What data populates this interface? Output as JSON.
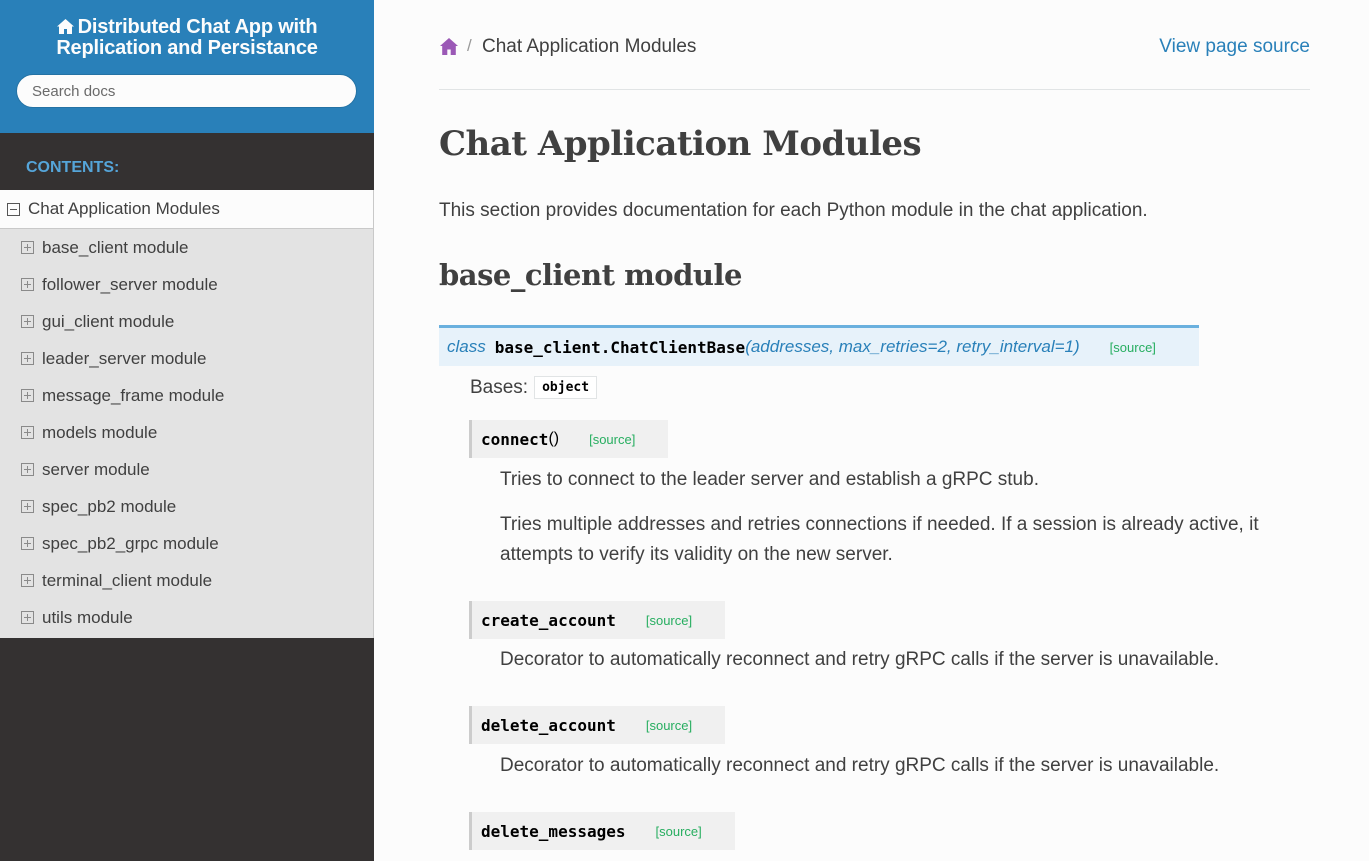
{
  "sidebar": {
    "project_title_line1": "Distributed Chat App with",
    "project_title_line2": "Replication and Persistance",
    "search_placeholder": "Search docs",
    "caption": "CONTENTS:",
    "current_item": "Chat Application Modules",
    "items": [
      {
        "label": "base_client module"
      },
      {
        "label": "follower_server module"
      },
      {
        "label": "gui_client module"
      },
      {
        "label": "leader_server module"
      },
      {
        "label": "message_frame module"
      },
      {
        "label": "models module"
      },
      {
        "label": "server module"
      },
      {
        "label": "spec_pb2 module"
      },
      {
        "label": "spec_pb2_grpc module"
      },
      {
        "label": "terminal_client module"
      },
      {
        "label": "utils module"
      }
    ]
  },
  "breadcrumbs": {
    "separator": "/",
    "current": "Chat Application Modules",
    "view_source": "View page source"
  },
  "main": {
    "title": "Chat Application Modules",
    "intro": "This section provides documentation for each Python module in the chat application.",
    "section_title": "base_client module",
    "class_sig": {
      "keyword": "class",
      "name": "base_client.ChatClientBase",
      "params": "(addresses, max_retries=2, retry_interval=1)",
      "source": "[source]"
    },
    "bases_label": "Bases:",
    "bases_value": "object",
    "methods": [
      {
        "name": "connect",
        "parens": "()",
        "source": "[source]",
        "desc1": "Tries to connect to the leader server and establish a gRPC stub.",
        "desc2": "Tries multiple addresses and retries connections if needed. If a session is already active, it attempts to verify its validity on the new server."
      },
      {
        "name": "create_account",
        "source": "[source]",
        "desc1": "Decorator to automatically reconnect and retry gRPC calls if the server is unavailable."
      },
      {
        "name": "delete_account",
        "source": "[source]",
        "desc1": "Decorator to automatically reconnect and retry gRPC calls if the server is unavailable."
      },
      {
        "name": "delete_messages",
        "source": "[source]"
      }
    ]
  },
  "colors": {
    "sidebar_header": "#2980b9",
    "sidebar_bg": "#343131",
    "link": "#2980b9",
    "source_link": "#27ae60",
    "home_icon": "#9b59b6"
  }
}
